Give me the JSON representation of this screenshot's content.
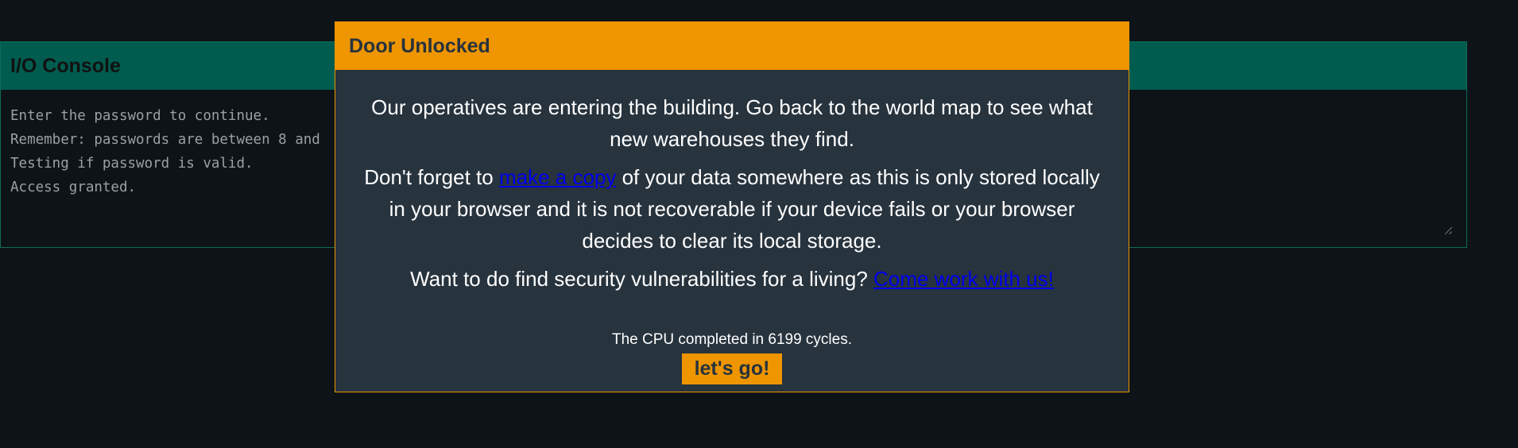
{
  "console": {
    "title": "I/O Console",
    "lines": [
      "Enter the password to continue.",
      "Remember: passwords are between 8 and",
      "Testing if password is valid.",
      "Access granted."
    ]
  },
  "modal": {
    "title": "Door Unlocked",
    "para1": "Our operatives are entering the building. Go back to the world map to see what new warehouses they find.",
    "para2_before": "Don't forget to ",
    "para2_link": "make a copy",
    "para2_after": " of your data somewhere as this is only stored locally in your browser and it is not recoverable if your device fails or your browser decides to clear its local storage.",
    "para3_before": "Want to do find security vulnerabilities for a living? ",
    "para3_link": "Come work with us!",
    "cycles_text": "The CPU completed in 6199 cycles.",
    "button_label": "let's go!"
  },
  "colors": {
    "accent": "#ee9500",
    "console_header": "#005c4f",
    "modal_bg": "#27333d",
    "page_bg": "#0e1318",
    "link": "#0000ee"
  }
}
